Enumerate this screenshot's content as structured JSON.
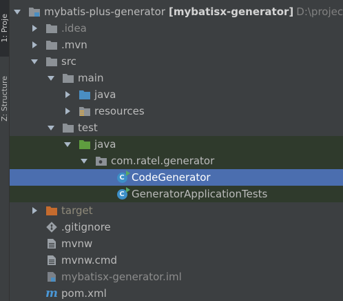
{
  "toolstrip": {
    "project_tab": "1: Proje",
    "structure_tab": "Z: Structure"
  },
  "colors": {
    "folder_gray": "#8c9196",
    "folder_blue": "#4a8ec2",
    "folder_green": "#5f9d3f",
    "folder_orange": "#c56b2e",
    "selection": "#4b6eaf",
    "test_highlight": "#2f3a2c",
    "text": "#bbbbbb"
  },
  "tree": {
    "root": {
      "name": "mybatis-plus-generator",
      "module": "[mybatisx-generator]",
      "path": "D:\\projec"
    },
    "idea": ".idea",
    "mvn": ".mvn",
    "src": "src",
    "main": "main",
    "main_java": "java",
    "resources": "resources",
    "test": "test",
    "test_java": "java",
    "package": "com.ratel.generator",
    "code_generator": "CodeGenerator",
    "app_tests": "GeneratorApplicationTests",
    "target": "target",
    "gitignore": ".gitignore",
    "mvnw": "mvnw",
    "mvnw_cmd": "mvnw.cmd",
    "iml": "mybatisx-generator.iml",
    "pom": "pom.xml"
  },
  "icons": {
    "expanded": "chevron-down-icon",
    "collapsed": "chevron-right-icon",
    "module": "module-folder-icon",
    "folder": "folder-icon",
    "source_root": "source-folder-icon",
    "resources_root": "resources-folder-icon",
    "test_root": "test-folder-icon",
    "package": "package-icon",
    "java_class": "java-class-icon",
    "excluded": "excluded-folder-icon",
    "git": "git-icon",
    "text_file": "text-file-icon",
    "maven": "maven-icon"
  }
}
